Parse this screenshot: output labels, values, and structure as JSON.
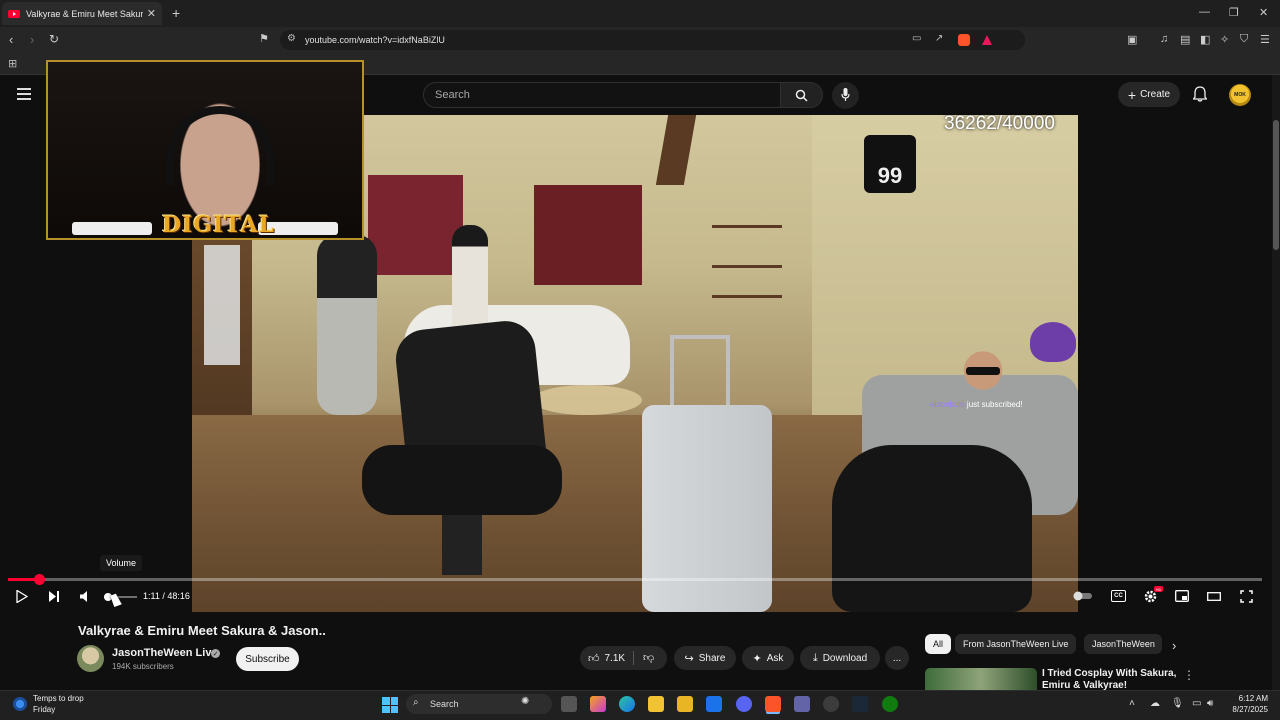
{
  "browser": {
    "tab_title": "Valkyrae & Emiru Meet Sakura &",
    "new_tab": "+",
    "url": "youtube.com/watch?v=idxfNaBiZlU"
  },
  "youtube": {
    "search_placeholder": "Search",
    "create_label": "Create",
    "avatar_text": "MOK"
  },
  "stream_overlay": {
    "counter": "36262/40000",
    "jersey_text": "99",
    "sub_user": "abloobulb",
    "sub_text": " just subscribed!",
    "logo_text": "DIGITAL"
  },
  "player": {
    "progress": 0.025,
    "current_time": "1:11",
    "duration": "48:16",
    "time_separator": " / ",
    "volume_tooltip": "Volume",
    "cc_label": "CC",
    "hd_badge": "HD"
  },
  "video": {
    "title": "Valkyrae & Emiru Meet Sakura & Jason..",
    "channel_name": "JasonTheWeen Live",
    "subscribers": "194K subscribers",
    "subscribe_label": "Subscribe",
    "like_count": "7.1K",
    "share_label": "Share",
    "ask_label": "Ask",
    "download_label": "Download",
    "more_label": "..."
  },
  "recommendations": {
    "chips": [
      "All",
      "From JasonTheWeen Live",
      "JasonTheWeen"
    ],
    "first_title": "I Tried Cosplay With Sakura, Emiru & Valkyrae!"
  },
  "taskbar": {
    "weather_line1": "Temps to drop",
    "weather_line2": "Friday",
    "search_label": "Search",
    "time": "6:12 AM",
    "date": "8/27/2025"
  },
  "colors": {
    "accent_red": "#ff0033",
    "background": "#0f0f0f",
    "logo_gold": "#e8a725"
  }
}
